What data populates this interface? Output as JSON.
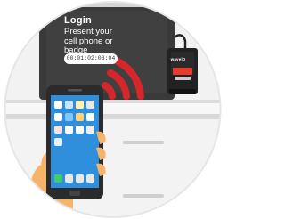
{
  "login": {
    "title": "Login",
    "prompt": "Present your cell phone or badge",
    "tag_id": "00:01:02:03:04"
  },
  "reader": {
    "brand": "wavelD"
  },
  "illustration": {
    "colors": {
      "background_circle": "#f2f2f2",
      "monitor": "#3a3a3a",
      "signal_waves": "#d6262c",
      "reader_body": "#222222",
      "reader_accent": "#e63b2e",
      "phone_screen": "#2f8fdc",
      "hand_skin": "#f6b36a",
      "sleeve": "#e0e0e0"
    },
    "icons": [
      "wifi-signal-icon",
      "card-reader-icon",
      "smartphone-icon",
      "hand-icon"
    ]
  }
}
